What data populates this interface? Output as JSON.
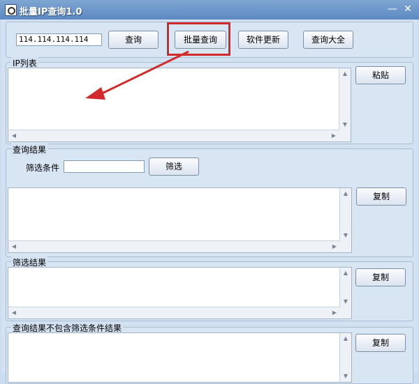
{
  "window": {
    "title": "批量IP查询1.0",
    "minimize": "—",
    "close": "✕"
  },
  "toolbar": {
    "ip_value": "114.114.114.114",
    "query_label": "查询",
    "batch_query_label": "批量查询",
    "update_label": "软件更新",
    "query_all_label": "查询大全"
  },
  "ip_list": {
    "legend": "IP列表",
    "paste_label": "粘贴"
  },
  "query_results": {
    "legend": "查询结果",
    "filter_label": "筛选条件",
    "filter_value": "",
    "filter_button": "筛选",
    "copy_label": "复制"
  },
  "filter_results": {
    "legend": "筛选结果",
    "copy_label": "复制"
  },
  "excluded_results": {
    "legend": "查询结果不包含筛选条件结果",
    "copy_label": "复制"
  },
  "arrows": {
    "up": "▲",
    "down": "▼",
    "left": "◀",
    "right": "▶"
  },
  "colors": {
    "annotation": "#d22a2a",
    "title_bar": "#6a93c8"
  }
}
